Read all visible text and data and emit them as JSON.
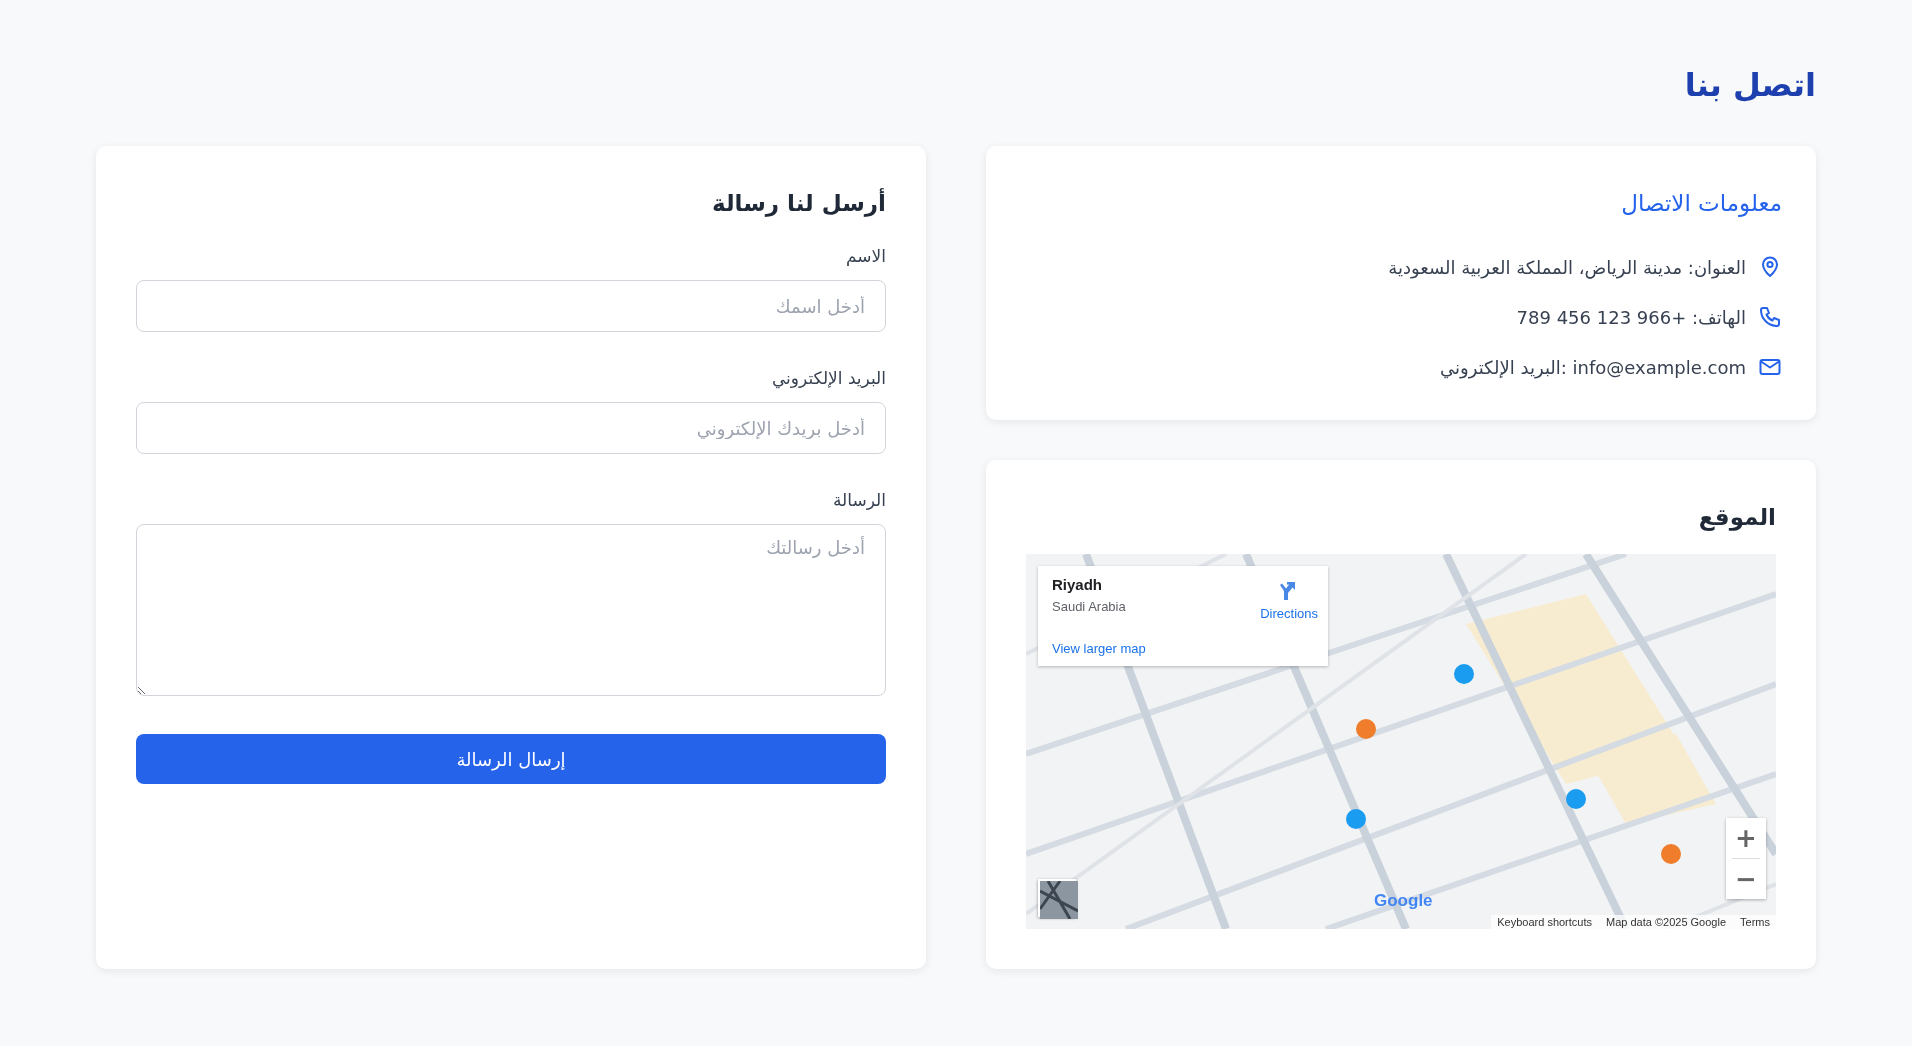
{
  "page_title": "اتصل بنا",
  "contact_info": {
    "title": "معلومات الاتصال",
    "items": [
      {
        "kind": "address",
        "text": "العنوان: مدينة الرياض، المملكة العربية السعودية"
      },
      {
        "kind": "phone",
        "text": "الهاتف: +966 123 456 789"
      },
      {
        "kind": "email",
        "text": "info@example.com :البريد الإلكتروني"
      }
    ]
  },
  "location": {
    "title": "الموقع",
    "map": {
      "kind": "picture",
      "place": "Riyadh",
      "region": "Saudi Arabia",
      "directions": "Directions",
      "larger_map_link": "View larger map",
      "zoom_in": "+",
      "zoom_out": "−",
      "logo": "Google",
      "footer_links": [
        "Terms",
        "Map data ©2025 Google",
        "Keyboard shortcuts"
      ]
    }
  },
  "form": {
    "title": "أرسل لنا رسالة",
    "fields": [
      {
        "kind": "text",
        "label": "الاسم",
        "placeholder": "أدخل اسمك"
      },
      {
        "kind": "email",
        "label": "البريد الإلكتروني",
        "placeholder": "أدخل بريدك الإلكتروني"
      },
      {
        "kind": "textarea",
        "label": "الرسالة",
        "placeholder": "أدخل رسالتك"
      }
    ],
    "submit": "إرسال الرسالة"
  }
}
